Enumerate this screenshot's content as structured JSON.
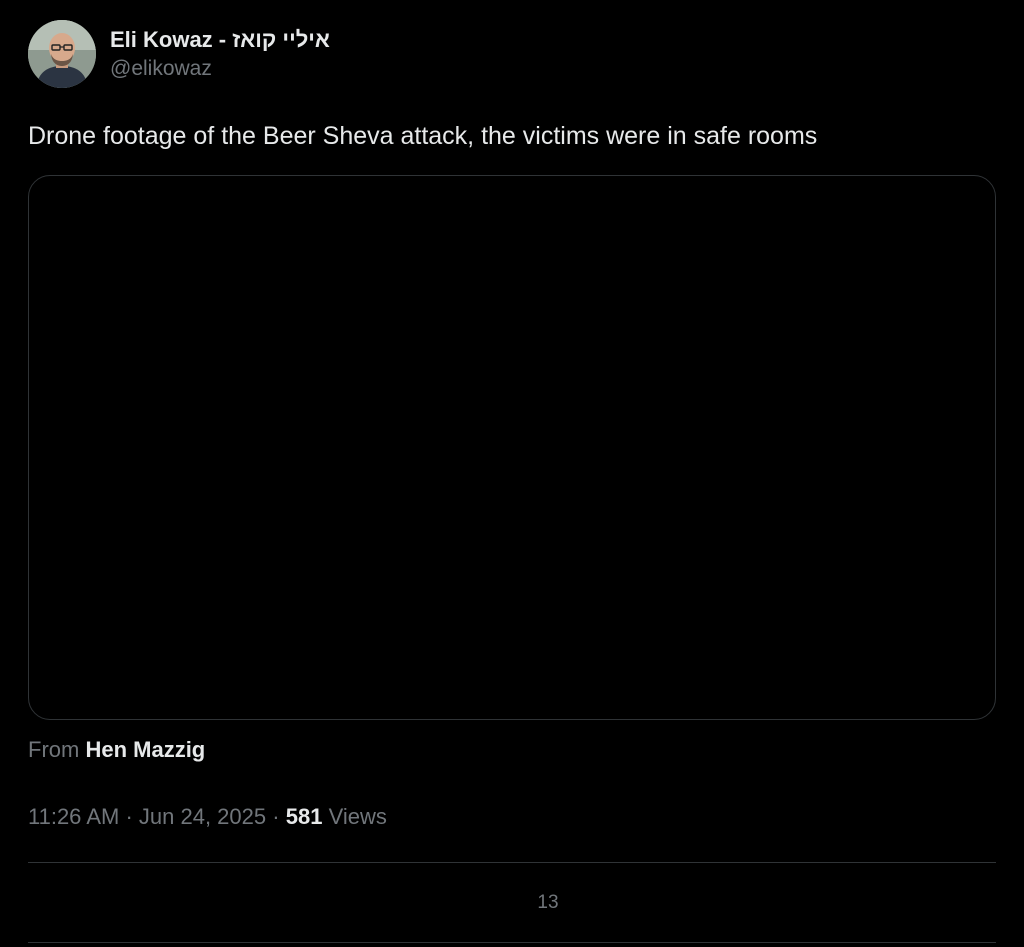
{
  "tweet": {
    "author": {
      "display_name": "Eli Kowaz - איליי קואז",
      "handle": "@elikowaz",
      "avatar_icon": "avatar-photo"
    },
    "text": "Drone footage of the Beer Sheva attack, the victims were in safe rooms",
    "media": {
      "type": "video"
    },
    "attribution": {
      "prefix": "From",
      "source": "Hen Mazzig"
    },
    "meta": {
      "time": "11:26 AM",
      "separator": "·",
      "date": "Jun 24, 2025",
      "views_count": "581",
      "views_label": "Views"
    },
    "engagement_count": "13"
  },
  "colors": {
    "background": "#000000",
    "primary_text": "#e7e9ea",
    "secondary_text": "#71767b",
    "border": "#2f3336"
  }
}
